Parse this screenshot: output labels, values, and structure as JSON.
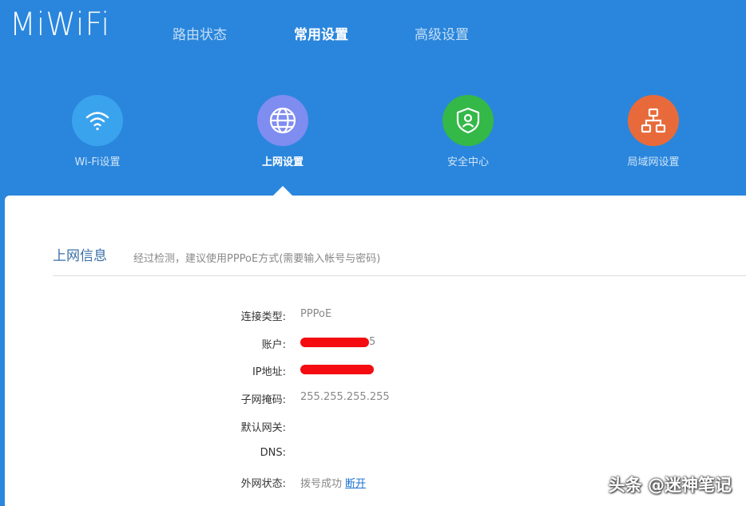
{
  "app": {
    "logo": "MiWiFi"
  },
  "nav": {
    "tabs": [
      {
        "label": "路由状态",
        "active": false
      },
      {
        "label": "常用设置",
        "active": true
      },
      {
        "label": "高级设置",
        "active": false
      }
    ]
  },
  "categories": [
    {
      "label": "Wi-Fi设置",
      "icon": "wifi-icon",
      "color": "#3aa3ee",
      "active": false
    },
    {
      "label": "上网设置",
      "icon": "globe-icon",
      "color": "#7f8cf0",
      "active": true
    },
    {
      "label": "安全中心",
      "icon": "shield-icon",
      "color": "#34b848",
      "active": false
    },
    {
      "label": "局域网设置",
      "icon": "lan-icon",
      "color": "#e86a3a",
      "active": false
    }
  ],
  "section": {
    "title": "上网信息",
    "hint": "经过检测，建议使用PPPoE方式(需要输入帐号与密码)"
  },
  "info": {
    "connection_type": {
      "label": "连接类型:",
      "value": "PPPoE"
    },
    "account": {
      "label": "账户:",
      "value": "5"
    },
    "ip": {
      "label": "IP地址:"
    },
    "subnet": {
      "label": "子网掩码:",
      "value": "255.255.255.255"
    },
    "gateway": {
      "label": "默认网关:",
      "value": ""
    },
    "dns": {
      "label": "DNS:",
      "value": ""
    },
    "wan_status": {
      "label": "外网状态:",
      "value": "拨号成功",
      "action": "断开"
    }
  },
  "watermark": "头条 @迷神笔记",
  "colors": {
    "header_bg": "#2a86dc",
    "redaction": "#f40c10",
    "link": "#1a6fd0"
  }
}
